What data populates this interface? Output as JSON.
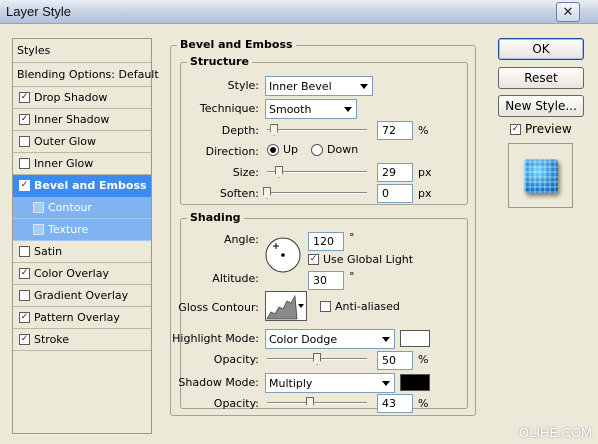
{
  "window": {
    "title": "Layer Style",
    "close_glyph": "✕"
  },
  "styles_panel": {
    "header": "Styles",
    "blending": "Blending Options: Default",
    "items": [
      {
        "label": "Drop Shadow",
        "checked": true
      },
      {
        "label": "Inner Shadow",
        "checked": true
      },
      {
        "label": "Outer Glow",
        "checked": false
      },
      {
        "label": "Inner Glow",
        "checked": false
      },
      {
        "label": "Bevel and Emboss",
        "checked": true,
        "selected": true
      },
      {
        "label": "Contour",
        "checked": false,
        "sub": true
      },
      {
        "label": "Texture",
        "checked": false,
        "sub": true
      },
      {
        "label": "Satin",
        "checked": false
      },
      {
        "label": "Color Overlay",
        "checked": true
      },
      {
        "label": "Gradient Overlay",
        "checked": false
      },
      {
        "label": "Pattern Overlay",
        "checked": true
      },
      {
        "label": "Stroke",
        "checked": true
      }
    ]
  },
  "bevel": {
    "title": "Bevel and Emboss",
    "structure": {
      "title": "Structure",
      "style_label": "Style:",
      "style_value": "Inner Bevel",
      "technique_label": "Technique:",
      "technique_value": "Smooth",
      "depth_label": "Depth:",
      "depth_value": "72",
      "depth_unit": "%",
      "depth_level": 0.072,
      "direction_label": "Direction:",
      "direction_up": "Up",
      "direction_down": "Down",
      "direction_selected": "Up",
      "size_label": "Size:",
      "size_value": "29",
      "size_unit": "px",
      "size_level": 0.12,
      "soften_label": "Soften:",
      "soften_value": "0",
      "soften_unit": "px",
      "soften_level": 0.0
    },
    "shading": {
      "title": "Shading",
      "angle_label": "Angle:",
      "angle_value": "120",
      "angle_unit": "°",
      "use_global_light_label": "Use Global Light",
      "use_global_light_checked": true,
      "altitude_label": "Altitude:",
      "altitude_value": "30",
      "altitude_unit": "°",
      "gloss_contour_label": "Gloss Contour:",
      "anti_aliased_label": "Anti-aliased",
      "anti_aliased_checked": false,
      "highlight_mode_label": "Highlight Mode:",
      "highlight_mode_value": "Color Dodge",
      "highlight_color": "#ffffff",
      "highlight_opacity_label": "Opacity:",
      "highlight_opacity_value": "50",
      "highlight_opacity_unit": "%",
      "highlight_opacity_level": 0.5,
      "shadow_mode_label": "Shadow Mode:",
      "shadow_mode_value": "Multiply",
      "shadow_color": "#000000",
      "shadow_opacity_label": "Opacity:",
      "shadow_opacity_value": "43",
      "shadow_opacity_unit": "%",
      "shadow_opacity_level": 0.43
    }
  },
  "buttons": {
    "ok": "OK",
    "reset": "Reset",
    "new_style": "New Style...",
    "preview_label": "Preview",
    "preview_checked": true
  },
  "watermark": "OLIHE.COM"
}
